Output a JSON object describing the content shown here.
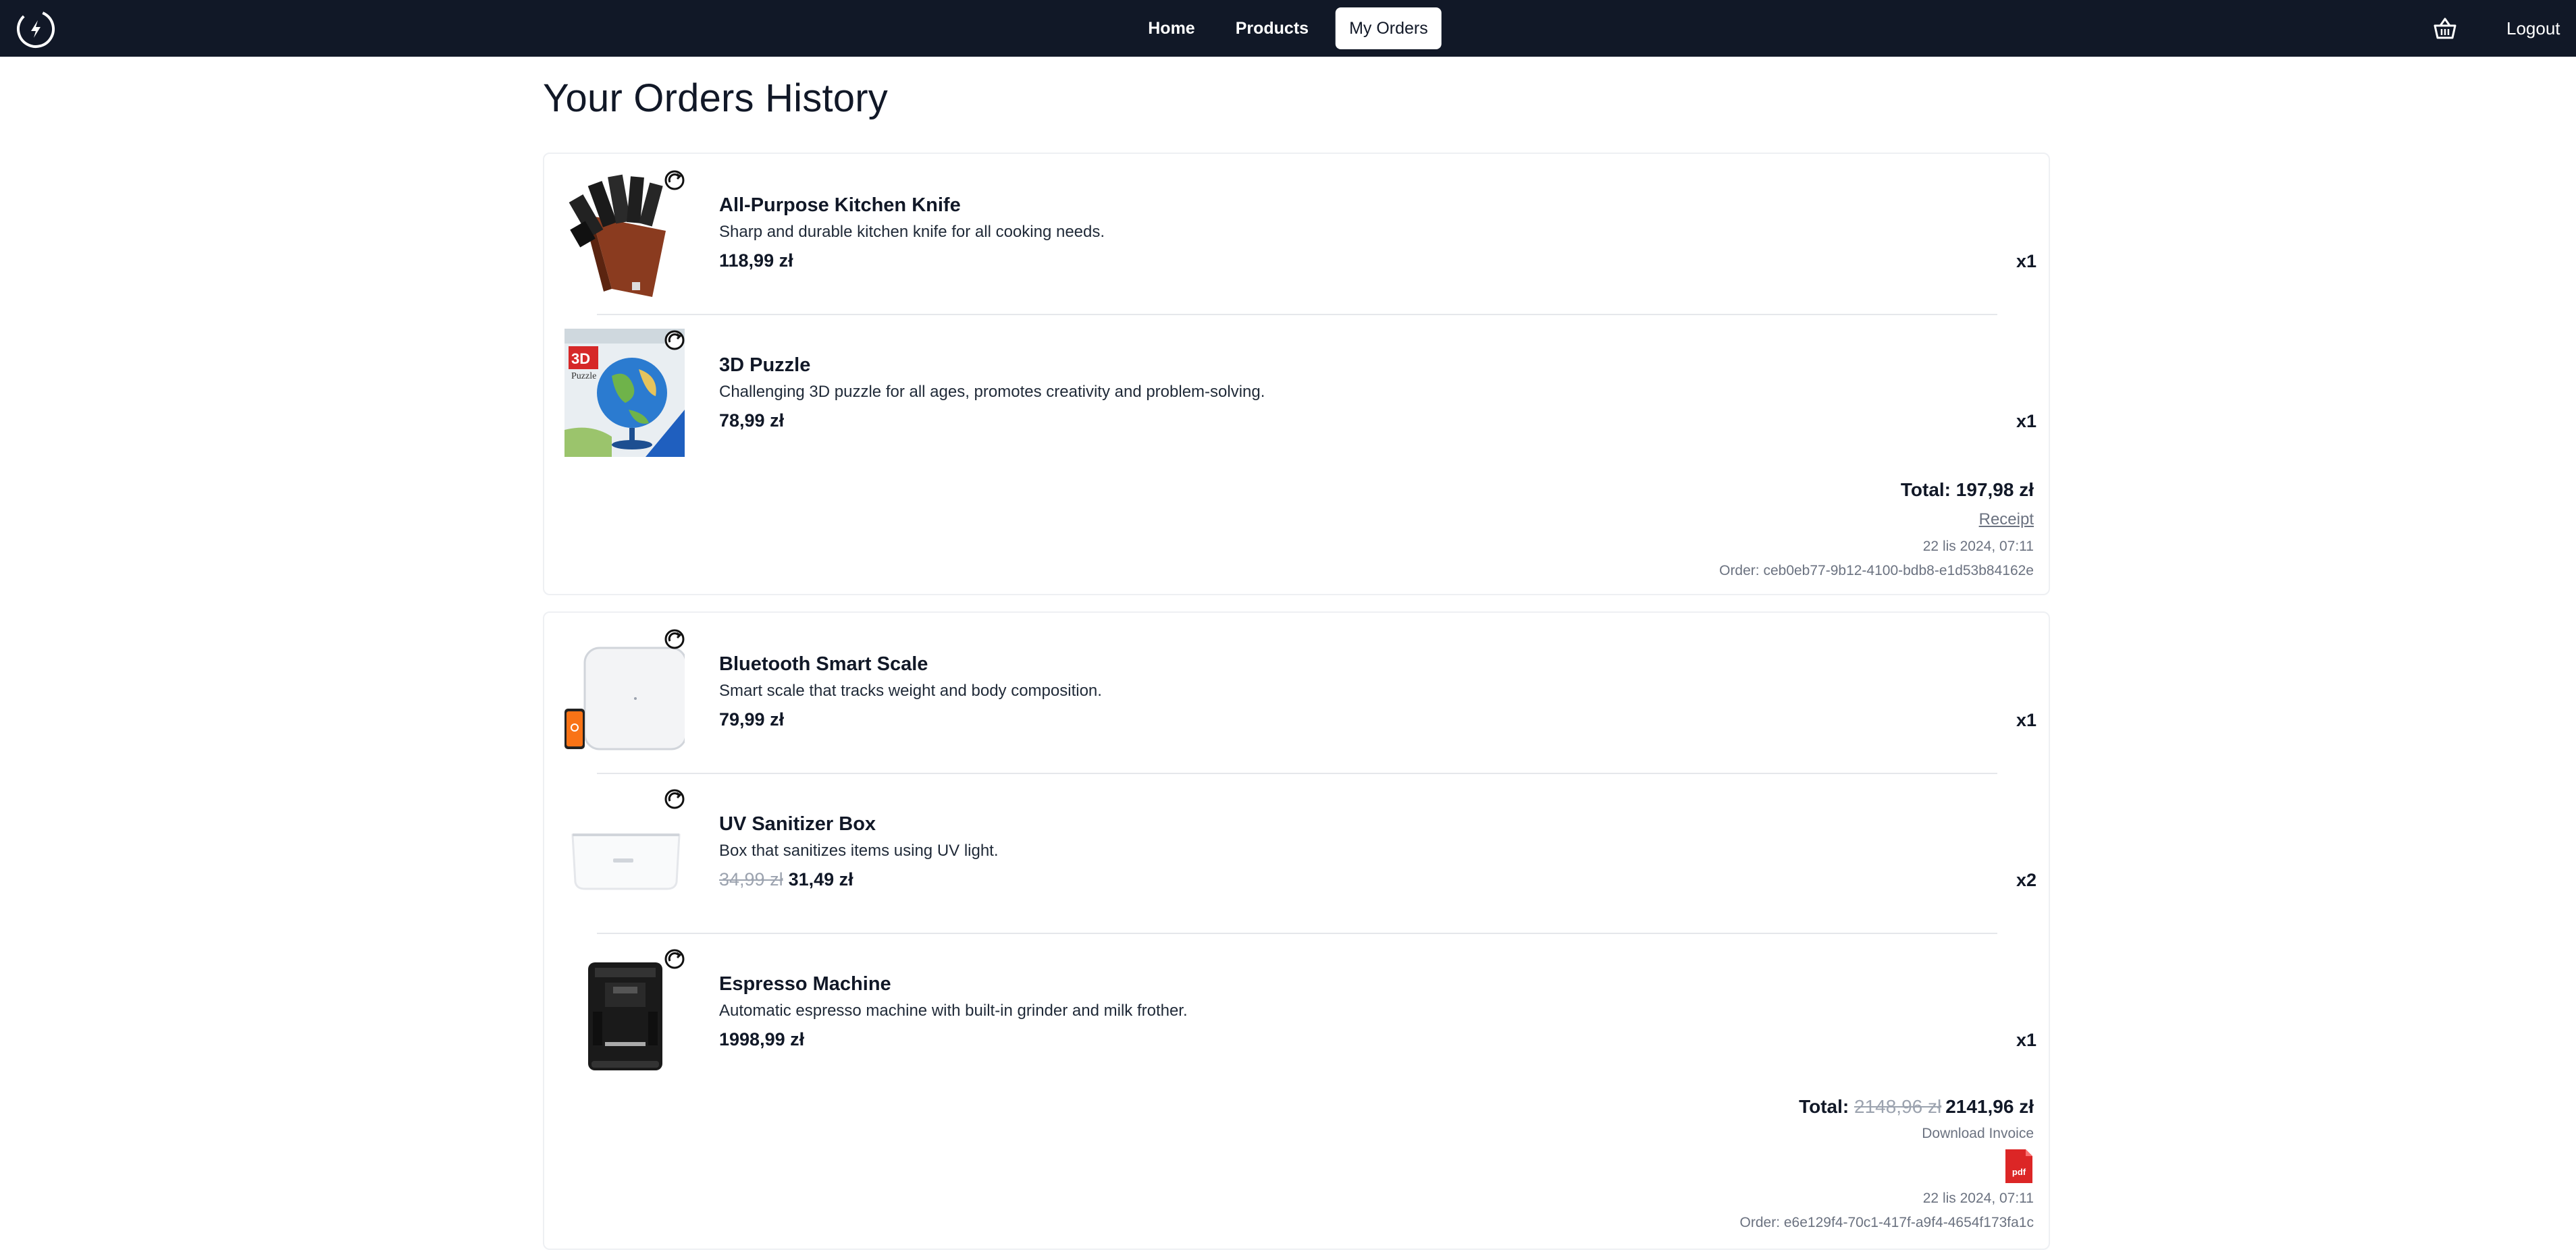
{
  "nav": {
    "home": "Home",
    "products": "Products",
    "my_orders": "My Orders",
    "logout": "Logout"
  },
  "page": {
    "title": "Your Orders History"
  },
  "orders": [
    {
      "items": [
        {
          "name": "All-Purpose Kitchen Knife",
          "description": "Sharp and durable kitchen knife for all cooking needs.",
          "price": "118,99 zł",
          "old_price": "",
          "qty": "x1",
          "icon": "knife-block-image"
        },
        {
          "name": "3D Puzzle",
          "description": "Challenging 3D puzzle for all ages, promotes creativity and problem-solving.",
          "price": "78,99 zł",
          "old_price": "",
          "qty": "x1",
          "icon": "globe-puzzle-image"
        }
      ],
      "total_label": "Total:",
      "total_old": "",
      "total": "197,98 zł",
      "receipt_label": "Receipt",
      "date": "22 lis 2024, 07:11",
      "order_id": "Order: ceb0eb77-9b12-4100-bdb8-e1d53b84162e"
    },
    {
      "items": [
        {
          "name": "Bluetooth Smart Scale",
          "description": "Smart scale that tracks weight and body composition.",
          "price": "79,99 zł",
          "old_price": "",
          "qty": "x1",
          "icon": "smart-scale-image"
        },
        {
          "name": "UV Sanitizer Box",
          "description": "Box that sanitizes items using UV light.",
          "price": "31,49 zł",
          "old_price": "34,99 zł",
          "qty": "x2",
          "icon": "uv-box-image"
        },
        {
          "name": "Espresso Machine",
          "description": "Automatic espresso machine with built-in grinder and milk frother.",
          "price": "1998,99 zł",
          "old_price": "",
          "qty": "x1",
          "icon": "espresso-machine-image"
        }
      ],
      "total_label": "Total:",
      "total_old": "2148,96 zł",
      "total": "2141,96 zł",
      "download_label": "Download Invoice",
      "pdf_label": "pdf",
      "date": "22 lis 2024, 07:11",
      "order_id": "Order: e6e129f4-70c1-417f-a9f4-4654f173fa1c"
    }
  ],
  "colors": {
    "navbar": "#111827",
    "accent_pdf": "#dc2626",
    "muted": "#6b7280"
  }
}
